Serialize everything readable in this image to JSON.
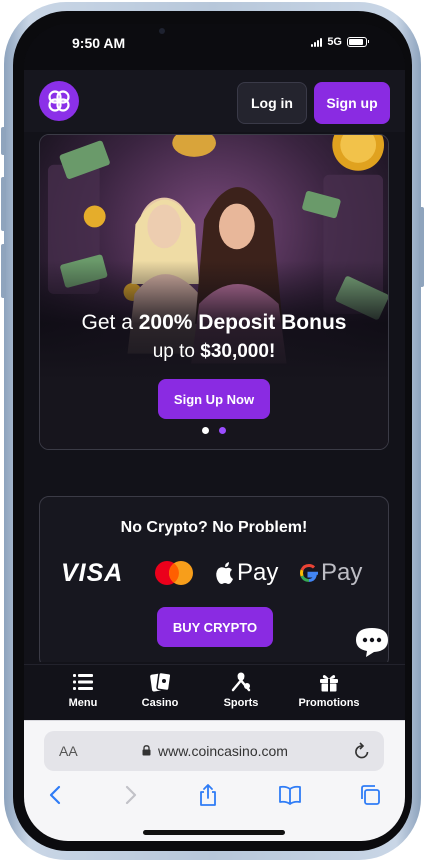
{
  "status_bar": {
    "time": "9:50 AM",
    "network": "5G",
    "battery_level": 0.9
  },
  "header": {
    "logo_icon": "coincasino-logo-icon",
    "login_label": "Log in",
    "signup_label": "Sign up",
    "accent_color": "#8a2be2"
  },
  "banner": {
    "line1_prefix": "Get a ",
    "line1_bold": "200% Deposit Bonus",
    "line2_prefix": "up to ",
    "line2_bold": "$30,000!",
    "cta_label": "Sign Up Now",
    "slide_count": 2,
    "active_slide": 2
  },
  "crypto": {
    "title": "No Crypto? No Problem!",
    "methods": [
      {
        "name": "VISA",
        "icon": "visa-icon"
      },
      {
        "name": "Mastercard",
        "icon": "mastercard-icon"
      },
      {
        "name": "Pay",
        "icon": "apple-pay-icon"
      },
      {
        "name": "Pay",
        "icon": "google-pay-icon"
      }
    ],
    "cta_label": "BUY CRYPTO"
  },
  "chat": {
    "icon": "chat-bubble-icon"
  },
  "bottom_nav": [
    {
      "label": "Menu",
      "icon": "menu-icon"
    },
    {
      "label": "Casino",
      "icon": "cards-icon"
    },
    {
      "label": "Sports",
      "icon": "sports-icon"
    },
    {
      "label": "Promotions",
      "icon": "gift-icon"
    }
  ],
  "browser": {
    "aa_label": "AA",
    "url": "www.coincasino.com",
    "toolbar_icons": [
      "back-icon",
      "forward-icon",
      "share-icon",
      "bookmarks-icon",
      "tabs-icon"
    ]
  }
}
